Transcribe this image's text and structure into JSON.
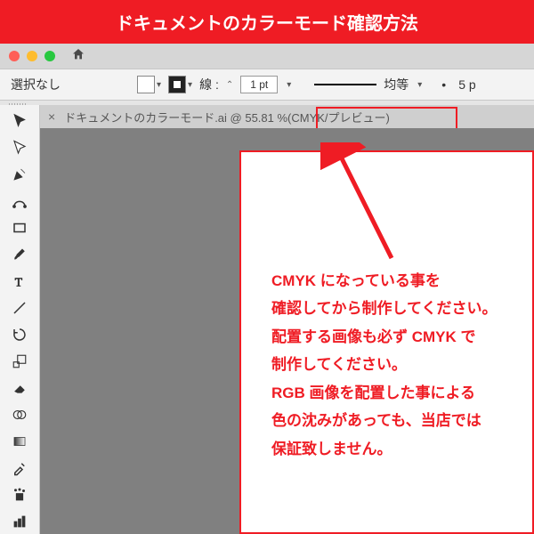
{
  "title": "ドキュメントのカラーモード確認方法",
  "control": {
    "selection": "選択なし",
    "stroke_label": "線 :",
    "stroke_value": "1 pt",
    "uniform_label": "均等",
    "bullet": "•",
    "five": "5 p"
  },
  "tab": {
    "close": "×",
    "file_name": "ドキュメントのカラーモード.ai @ 55.81 %",
    "mode": " (CMYK/プレビュー)"
  },
  "note": {
    "l1": "CMYK になっている事を",
    "l2": "確認してから制作してください。",
    "l3": "配置する画像も必ず CMYK で",
    "l4": "制作してください。",
    "l5": "RGB 画像を配置した事による",
    "l6": "色の沈みがあっても、当店では",
    "l7": "保証致しません。"
  },
  "tool_names": [
    "selection",
    "direct-select",
    "pen",
    "curvature",
    "rectangle",
    "brush",
    "type",
    "rotate",
    "width",
    "eraser",
    "shapebuilder",
    "mesh",
    "gradient",
    "eyedropper",
    "blend",
    "symbol",
    "column-graph",
    "artboard"
  ]
}
